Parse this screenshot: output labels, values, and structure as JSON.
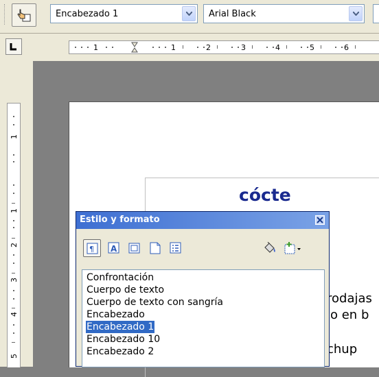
{
  "toolbar": {
    "paragraph_style": "Encabezado 1",
    "font_name": "Arial Black"
  },
  "ruler": {
    "h_labels": [
      "1",
      "1",
      "2",
      "3",
      "4",
      "5",
      "6"
    ],
    "v_labels": [
      "1",
      "1",
      "2",
      "3",
      "4",
      "5"
    ]
  },
  "document": {
    "title_fragment": "cócte",
    "line1": "rodajas",
    "line2": "lo en b",
    "line3": "chup"
  },
  "panel": {
    "title": "Estilo y formato",
    "styles": [
      {
        "label": "Confrontación",
        "selected": false
      },
      {
        "label": "Cuerpo de texto",
        "selected": false
      },
      {
        "label": "Cuerpo de texto con sangría",
        "selected": false
      },
      {
        "label": "Encabezado",
        "selected": false
      },
      {
        "label": "Encabezado 1",
        "selected": true
      },
      {
        "label": "Encabezado 10",
        "selected": false
      },
      {
        "label": "Encabezado 2",
        "selected": false
      }
    ]
  },
  "colors": {
    "selection": "#316ac5",
    "title_blue": "#1a2a8f",
    "panel_title": "#3e6fd2"
  }
}
